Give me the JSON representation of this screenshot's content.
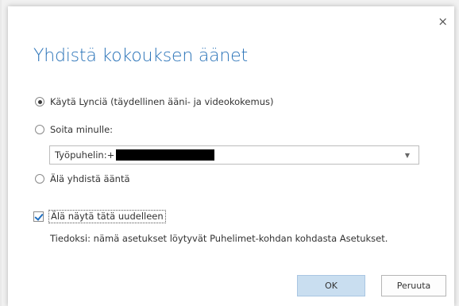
{
  "dialog": {
    "close_glyph": "×",
    "title": "Yhdistä kokouksen äänet"
  },
  "options": {
    "use_lync": "Käytä Lynciä (täydellinen ääni- ja videokokemus)",
    "call_me": "Soita minulle:",
    "dont_connect": "Älä yhdistä ääntä"
  },
  "phone_select": {
    "value_prefix": "Työpuhelin:+",
    "caret": "▼"
  },
  "dont_show": {
    "label": "Älä näytä tätä uudelleen",
    "checked": true
  },
  "info_text": "Tiedoksi: nämä asetukset löytyvät Puhelimet-kohdan kohdasta Asetukset.",
  "buttons": {
    "ok": "OK",
    "cancel": "Peruuta"
  }
}
